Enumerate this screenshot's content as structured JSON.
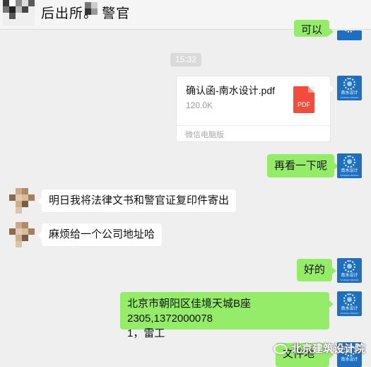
{
  "header": {
    "title": "后出所。  警官"
  },
  "colors": {
    "bubble_sent": "#95ec69",
    "bubble_received": "#ffffff",
    "background": "#efefef",
    "pdf_red": "#f24c3d",
    "brand_blue": "#1f6fbf"
  },
  "company_avatar": {
    "name": "南水设计",
    "sub": "NANSHUI DESIGN"
  },
  "messages": {
    "partial_top": "可以",
    "timestamp": "15:32",
    "file": {
      "name": "确认函-南水设计.pdf",
      "size": "120.0K",
      "type_label": "PDF",
      "source": "微信电脑版",
      "icon": "pdf-file-icon"
    },
    "sent_1": "再看一下呢",
    "received_1": "明日我将法律文书和警官证复印件寄出",
    "received_2": "麻烦给一个公司地址哈",
    "sent_2": "好的",
    "sent_3_line1": "北京市朝阳区佳境天城B座2305,1372000078",
    "sent_3_line2": "1，雷工",
    "sent_4": "文件地址"
  },
  "watermark": {
    "text": "北京建筑设计院",
    "icon": "wechat-channel-icon"
  }
}
